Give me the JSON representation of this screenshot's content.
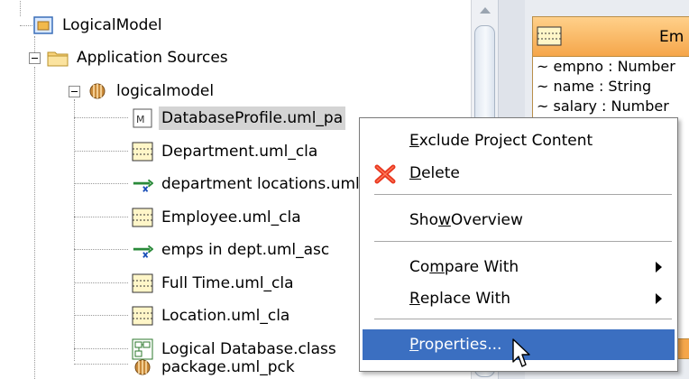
{
  "tree": {
    "items": [
      {
        "label": "LogicalModel",
        "icon": "project-icon"
      },
      {
        "label": "Application Sources",
        "icon": "folder-icon"
      },
      {
        "label": "logicalmodel",
        "icon": "package-icon"
      },
      {
        "label": "DatabaseProfile.uml_pa",
        "icon": "profile-icon",
        "selected": true
      },
      {
        "label": "Department.uml_cla",
        "icon": "class-icon"
      },
      {
        "label": "department locations.uml_asc",
        "icon": "association-icon"
      },
      {
        "label": "Employee.uml_cla",
        "icon": "class-icon"
      },
      {
        "label": "emps in dept.uml_asc",
        "icon": "association-icon"
      },
      {
        "label": "Full Time.uml_cla",
        "icon": "class-icon"
      },
      {
        "label": "Location.uml_cla",
        "icon": "class-icon"
      },
      {
        "label": "Logical Database.class",
        "icon": "diagram-icon"
      },
      {
        "label": "package.uml_pck",
        "icon": "package-icon"
      }
    ]
  },
  "diagram": {
    "class_name": "Em",
    "attributes": [
      "~ empno : Number",
      "~ name : String",
      "~ salary : Number"
    ]
  },
  "context_menu": {
    "exclude": {
      "pre": "",
      "key": "E",
      "post": "xclude Project Content"
    },
    "delete": {
      "pre": "",
      "key": "D",
      "post": "elete"
    },
    "overview": {
      "pre": "Sho",
      "key": "w",
      "post": " Overview"
    },
    "compare": {
      "pre": "Co",
      "key": "m",
      "post": "pare With"
    },
    "replace": {
      "pre": "",
      "key": "R",
      "post": "eplace With"
    },
    "properties": {
      "pre": "",
      "key": "P",
      "post": "roperties..."
    }
  },
  "colors": {
    "menu_highlight": "#3b6fc1",
    "selection_bg": "#d4d4d4",
    "uml_header": "#f5a64a",
    "delete_icon": "#e8361e"
  }
}
